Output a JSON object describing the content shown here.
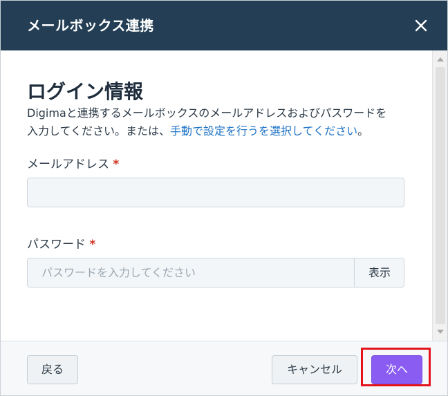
{
  "dialog": {
    "title": "メールボックス連携",
    "close_icon": "close-icon"
  },
  "content": {
    "heading": "ログイン情報",
    "description_line1": "Digimaと連携するメールボックスのメールアドレスおよびパスワードを",
    "description_line2_prefix": "入力してください。または、",
    "manual_link": "手動で設定を行うを選択してください",
    "description_line2_suffix": "。"
  },
  "form": {
    "email": {
      "label": "メールアドレス",
      "required_mark": "*",
      "value": "",
      "placeholder": ""
    },
    "password": {
      "label": "パスワード",
      "required_mark": "*",
      "value": "",
      "placeholder": "パスワードを入力してください",
      "show_label": "表示"
    }
  },
  "footer": {
    "back_label": "戻る",
    "cancel_label": "キャンセル",
    "next_label": "次へ"
  },
  "colors": {
    "header_bg": "#243f55",
    "primary_button": "#8a5cf2",
    "link": "#1e73c6",
    "required": "#d0321e",
    "highlight_box": "#e3141c"
  }
}
